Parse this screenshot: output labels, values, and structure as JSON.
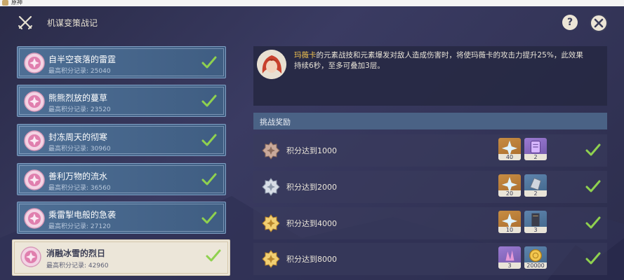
{
  "window": {
    "title": "原神"
  },
  "header": {
    "title": "机谋变策战记",
    "help_label": "?"
  },
  "stages": [
    {
      "name": "自半空衰落的雷霆",
      "score_label": "最高积分记录",
      "score": "25040",
      "completed": true,
      "selected": false
    },
    {
      "name": "熊熊烈放的蔓草",
      "score_label": "最高积分记录",
      "score": "23520",
      "completed": true,
      "selected": false
    },
    {
      "name": "封冻周天的彻寒",
      "score_label": "最高积分记录",
      "score": "30960",
      "completed": true,
      "selected": false
    },
    {
      "name": "善利万物的流水",
      "score_label": "最高积分记录",
      "score": "36560",
      "completed": true,
      "selected": false
    },
    {
      "name": "乘雷掣电般的急袭",
      "score_label": "最高积分记录",
      "score": "27120",
      "completed": true,
      "selected": false
    },
    {
      "name": "消融冰雪的烈日",
      "score_label": "最高积分记录",
      "score": "42960",
      "completed": true,
      "selected": true
    }
  ],
  "description": {
    "highlight": "玛薇卡",
    "line1": "的元素战技和元素爆发对敌人造成伤害时，将使玛薇卡的攻击力提升25%，此效果",
    "line2": "持续6秒，至多可叠加3层。"
  },
  "rewards": {
    "title": "挑战奖励",
    "rows": [
      {
        "label": "积分达到1000",
        "medal": "bronze",
        "items": [
          {
            "type": "primogem",
            "count": "40"
          },
          {
            "type": "hero-wit",
            "count": "2"
          }
        ],
        "claimed": true
      },
      {
        "label": "积分达到2000",
        "medal": "silver",
        "items": [
          {
            "type": "primogem",
            "count": "20"
          },
          {
            "type": "mystic-enhancement-ore",
            "count": "2"
          }
        ],
        "claimed": true
      },
      {
        "label": "积分达到4000",
        "medal": "gold",
        "items": [
          {
            "type": "primogem",
            "count": "10"
          },
          {
            "type": "talent-book",
            "count": "3"
          }
        ],
        "claimed": true
      },
      {
        "label": "积分达到8000",
        "medal": "gold",
        "items": [
          {
            "type": "crystal",
            "count": "3"
          },
          {
            "type": "mora",
            "count": "20000"
          }
        ],
        "claimed": true
      }
    ]
  },
  "colors": {
    "accent_gold": "#f1c24f",
    "check_green": "#8fd14f",
    "panel_blue": "#4a6285"
  }
}
